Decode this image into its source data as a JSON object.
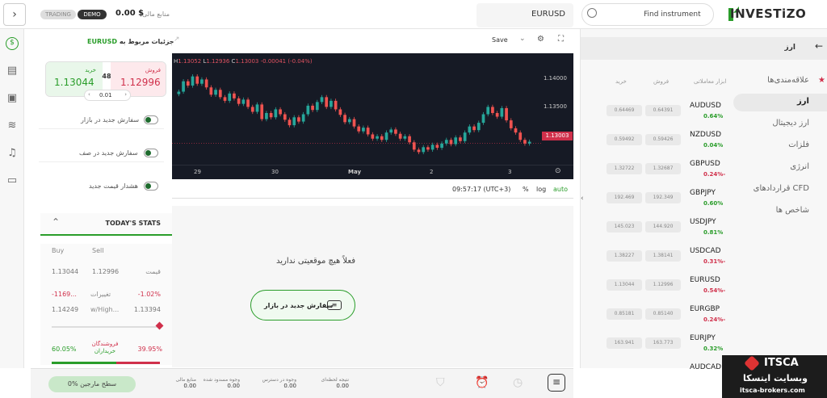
{
  "topbar": {
    "trading_label": "TRADING",
    "demo_label": "DEMO",
    "balance_value": "0.00 $",
    "balance_label": "منابع مالی",
    "symbol_tab": "EURUSD",
    "search_placeholder": "Find instrument",
    "brand": "INVESTiZO"
  },
  "details": {
    "title": "جزئیات مربوط به",
    "symbol": "EURUSD",
    "sell_label": "فروش",
    "sell_price": "1.12996",
    "buy_label": "خرید",
    "buy_price": "1.13044",
    "spread": "48",
    "lot": "0.01",
    "options": [
      {
        "label": "سفارش جدید در بازار"
      },
      {
        "label": "سفارش جدید در صف"
      },
      {
        "label": "هشدار قیمت جدید"
      }
    ],
    "stats_title": "TODAY'S STATS",
    "col_buy": "Buy",
    "col_sell": "Sell",
    "price_label": "قیمت",
    "price_buy": "1.13044",
    "price_sell": "1.12996",
    "change_label": "تغییرات",
    "change_buy": "-1169...",
    "change_sell": "-1.02%",
    "highlow_label": "w/High...",
    "highlow_buy": "1.14249",
    "highlow_sell": "1.13394",
    "sellers_label": "فروشندگان",
    "buyers_label": "خریداران",
    "sellers_pct": "39.95%",
    "buyers_pct": "60.05%"
  },
  "chart": {
    "symbol": "EURUSD",
    "save_label": "Save",
    "ohlc": {
      "h": "H",
      "h_val": "1.13052",
      "l": "L",
      "l_val": "1.12936",
      "c": "C",
      "c_val": "1.13003",
      "chg": "-0.00041 (-0.04%)"
    },
    "time": "09:57:17 (UTC+3)",
    "pct_label": "%",
    "log_label": "log",
    "auto_label": "auto",
    "current_price": "1.13003"
  },
  "chart_data": {
    "type": "candlestick",
    "y_ticks": [
      "1.14000",
      "1.13500"
    ],
    "x_ticks": [
      "29",
      "30",
      "May",
      "2",
      "3"
    ],
    "ylim": [
      1.1268,
      1.1432
    ],
    "current_price": 1.13003,
    "closes": [
      1.1385,
      1.1402,
      1.1395,
      1.141,
      1.1398,
      1.1405,
      1.1392,
      1.138,
      1.1388,
      1.1376,
      1.137,
      1.1382,
      1.1374,
      1.1365,
      1.1372,
      1.136,
      1.1352,
      1.1364,
      1.134,
      1.135,
      1.1343,
      1.1356,
      1.1348,
      1.1339,
      1.133,
      1.1343,
      1.1336,
      1.1348,
      1.1362,
      1.1355,
      1.1368,
      1.1376,
      1.136,
      1.137,
      1.1356,
      1.1347,
      1.1335,
      1.134,
      1.1328,
      1.132,
      1.1326,
      1.1315,
      1.1308,
      1.1312,
      1.1306,
      1.1318,
      1.1323,
      1.1316,
      1.1308,
      1.1312,
      1.1302,
      1.129,
      1.1286,
      1.1294,
      1.129,
      1.1298,
      1.1293,
      1.13,
      1.1306,
      1.1299,
      1.131,
      1.1304,
      1.1318,
      1.1328,
      1.1322,
      1.1334,
      1.1348,
      1.136,
      1.135,
      1.1344,
      1.1358,
      1.1338,
      1.1325,
      1.1318,
      1.1306,
      1.13,
      1.1303
    ]
  },
  "positions": {
    "empty_text": "فعلاً هیچ موقعیتی ندارید",
    "new_order_button": "سفارش جدید در بازار"
  },
  "bottom_bar": {
    "margin_level": "سطح مارجین %0",
    "items": [
      {
        "label": "منابع مالی",
        "value": "0.00"
      },
      {
        "label": "وجوه مسدود شده",
        "value": "0.00"
      },
      {
        "label": "وجوه در دسترس",
        "value": "0.00"
      },
      {
        "label": "نتیجه لحظه‌ای",
        "value": "0.00"
      }
    ]
  },
  "instruments": {
    "category_title": "ارز",
    "col_instruments": "ابزار معاملاتی",
    "col_sell": "فروش",
    "col_buy": "خرید",
    "categories": [
      {
        "label": "علاقه‌مندی‌ها",
        "active": false
      },
      {
        "label": "ارز",
        "active": true
      },
      {
        "label": "ارز دیجیتال",
        "active": false
      },
      {
        "label": "فلزات",
        "active": false
      },
      {
        "label": "انرژی",
        "active": false
      },
      {
        "label": "قراردادهای CFD",
        "active": false
      },
      {
        "label": "شاخص ها",
        "active": false
      }
    ],
    "rows": [
      {
        "symbol": "AUDUSD",
        "change": "0.64%",
        "dir": "up",
        "sell": "0.64391",
        "buy": "0.64469"
      },
      {
        "symbol": "NZDUSD",
        "change": "0.04%",
        "dir": "up",
        "sell": "0.59426",
        "buy": "0.59492"
      },
      {
        "symbol": "GBPUSD",
        "change": "0.24%-",
        "dir": "down",
        "sell": "1.32687",
        "buy": "1.32722"
      },
      {
        "symbol": "GBPJPY",
        "change": "0.60%",
        "dir": "up",
        "sell": "192.349",
        "buy": "192.469"
      },
      {
        "symbol": "USDJPY",
        "change": "0.81%",
        "dir": "up",
        "sell": "144.920",
        "buy": "145.023"
      },
      {
        "symbol": "USDCAD",
        "change": "0.31%-",
        "dir": "down",
        "sell": "1.38141",
        "buy": "1.38227"
      },
      {
        "symbol": "EURUSD",
        "change": "0.54%-",
        "dir": "down",
        "sell": "1.12996",
        "buy": "1.13044"
      },
      {
        "symbol": "EURGBP",
        "change": "0.24%-",
        "dir": "down",
        "sell": "0.85140",
        "buy": "0.85181"
      },
      {
        "symbol": "EURJPY",
        "change": "0.32%",
        "dir": "up",
        "sell": "163.773",
        "buy": "163.941"
      },
      {
        "symbol": "AUDCAD",
        "change": "",
        "dir": "up",
        "sell": "",
        "buy": ""
      }
    ]
  },
  "watermark": {
    "logo_text": "ITSCA",
    "site_label": "وبسایت ایتسکا",
    "url": "itsca-brokers.com"
  }
}
